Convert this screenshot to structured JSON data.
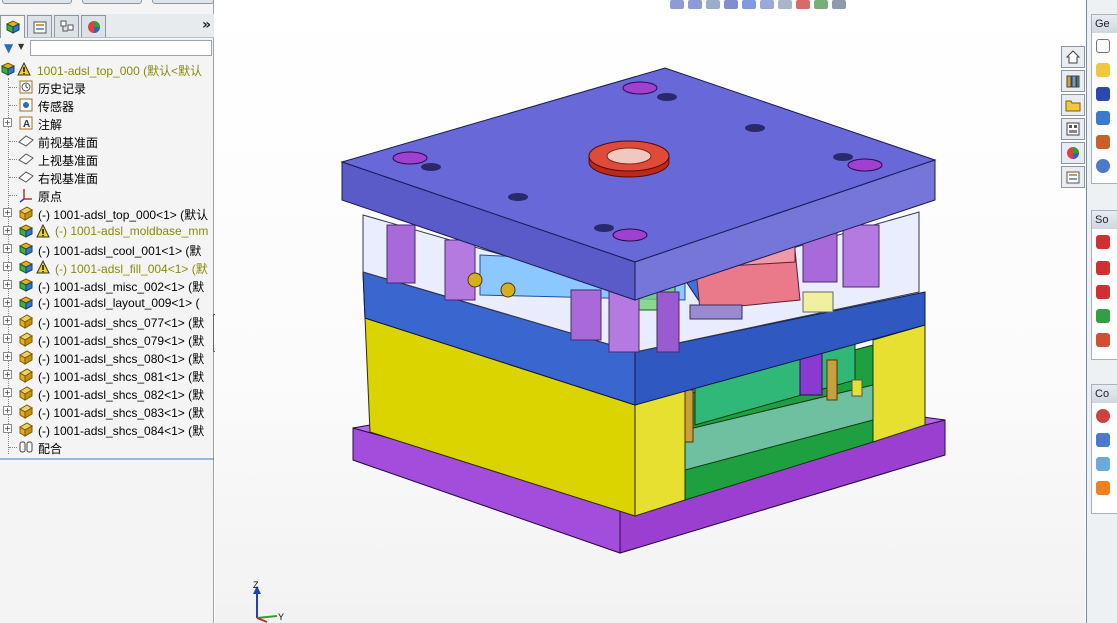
{
  "feature_tree": {
    "root": {
      "label": "1001-adsl_top_000  (默认<默认",
      "warning": true
    },
    "items": [
      {
        "label": "历史记录",
        "icon": "history-icon",
        "expandable": false,
        "warning": false
      },
      {
        "label": "传感器",
        "icon": "sensor-icon",
        "expandable": false,
        "warning": false
      },
      {
        "label": "注解",
        "icon": "annotation-icon",
        "expandable": true,
        "warning": false
      },
      {
        "label": "前视基准面",
        "icon": "plane-icon",
        "expandable": false,
        "warning": false
      },
      {
        "label": "上视基准面",
        "icon": "plane-icon",
        "expandable": false,
        "warning": false
      },
      {
        "label": "右视基准面",
        "icon": "plane-icon",
        "expandable": false,
        "warning": false
      },
      {
        "label": "原点",
        "icon": "origin-icon",
        "expandable": false,
        "warning": false
      },
      {
        "label": "(-) 1001-adsl_top_000<1> (默认",
        "icon": "part-icon",
        "expandable": true,
        "warning": false
      },
      {
        "label": "(-) 1001-adsl_moldbase_mm",
        "icon": "subassembly-icon",
        "expandable": true,
        "warning": true
      },
      {
        "label": "(-) 1001-adsl_cool_001<1> (默",
        "icon": "subassembly-icon",
        "expandable": true,
        "warning": false
      },
      {
        "label": "(-) 1001-adsl_fill_004<1> (默",
        "icon": "subassembly-icon",
        "expandable": true,
        "warning": true
      },
      {
        "label": "(-) 1001-adsl_misc_002<1> (默",
        "icon": "subassembly-icon",
        "expandable": true,
        "warning": false
      },
      {
        "label": "(-) 1001-adsl_layout_009<1> (",
        "icon": "subassembly-icon",
        "expandable": true,
        "warning": false
      },
      {
        "label": "(-) 1001-adsl_shcs_077<1> (默",
        "icon": "part-icon",
        "expandable": true,
        "warning": false
      },
      {
        "label": "(-) 1001-adsl_shcs_079<1> (默",
        "icon": "part-icon",
        "expandable": true,
        "warning": false
      },
      {
        "label": "(-) 1001-adsl_shcs_080<1> (默",
        "icon": "part-icon",
        "expandable": true,
        "warning": false
      },
      {
        "label": "(-) 1001-adsl_shcs_081<1> (默",
        "icon": "part-icon",
        "expandable": true,
        "warning": false
      },
      {
        "label": "(-) 1001-adsl_shcs_082<1> (默",
        "icon": "part-icon",
        "expandable": true,
        "warning": false
      },
      {
        "label": "(-) 1001-adsl_shcs_083<1> (默",
        "icon": "part-icon",
        "expandable": true,
        "warning": false
      },
      {
        "label": "(-) 1001-adsl_shcs_084<1> (默",
        "icon": "part-icon",
        "expandable": true,
        "warning": false
      },
      {
        "label": "配合",
        "icon": "mates-icon",
        "expandable": false,
        "warning": false
      }
    ]
  },
  "panel": {
    "expand_glyph": "»",
    "tabs": [
      "feature-manager-tab",
      "property-manager-tab",
      "configuration-manager-tab",
      "display-manager-tab"
    ]
  },
  "triad": {
    "z": "Z",
    "y": "Y"
  },
  "task_pane": {
    "headers": [
      "Ge",
      "So",
      "Co"
    ]
  },
  "colors": {
    "top_plate": "#6b6bd6",
    "plate_blue": "#3b64c8",
    "cavity_yellow": "#d9d200",
    "bottom_plate": "#9b3fd0",
    "sprue_red": "#d23a2a",
    "core_green": "#32b478"
  }
}
